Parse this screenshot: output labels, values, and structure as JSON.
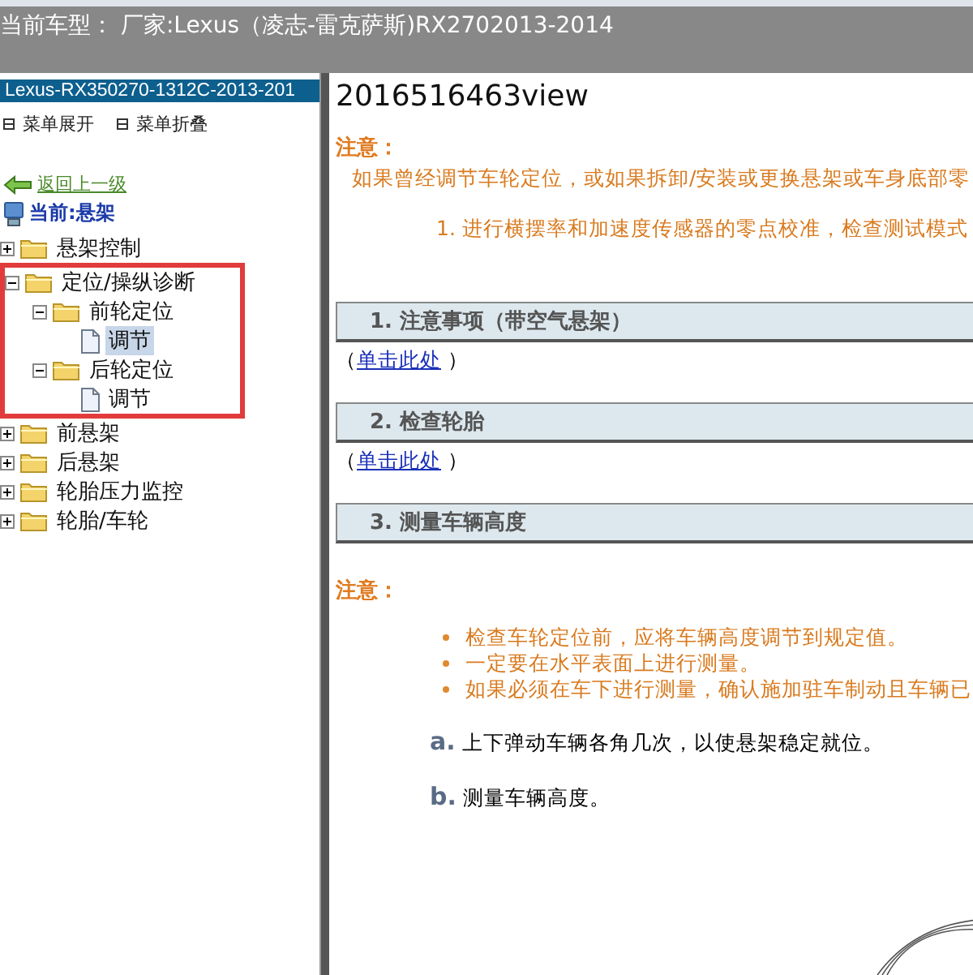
{
  "header": {
    "title": "当前车型： 厂家:Lexus（凌志-雷克萨斯)RX2702013-2014"
  },
  "sidebar": {
    "title": "Lexus-RX350270-1312C-2013-201",
    "actions": [
      {
        "label": "菜单展开"
      },
      {
        "label": "菜单折叠"
      }
    ],
    "back_link": "返回上一级",
    "current": "当前:悬架",
    "tree": [
      {
        "label": "悬架控制",
        "kind": "folder",
        "expanded": false,
        "selected": false,
        "highlighted": false
      },
      {
        "label": "定位/操纵诊断",
        "kind": "folder",
        "expanded": true,
        "selected": false,
        "highlighted": true,
        "children": [
          {
            "label": "前轮定位",
            "kind": "folder",
            "expanded": true,
            "selected": false,
            "highlighted": false,
            "children": [
              {
                "label": "调节",
                "kind": "page",
                "selected": true,
                "highlighted": false
              }
            ]
          },
          {
            "label": "后轮定位",
            "kind": "folder",
            "expanded": true,
            "selected": false,
            "highlighted": false,
            "children": [
              {
                "label": "调节",
                "kind": "page",
                "selected": false,
                "highlighted": false
              }
            ]
          }
        ]
      },
      {
        "label": "前悬架",
        "kind": "folder",
        "expanded": false,
        "selected": false,
        "highlighted": false
      },
      {
        "label": "后悬架",
        "kind": "folder",
        "expanded": false,
        "selected": false,
        "highlighted": false
      },
      {
        "label": "轮胎压力监控",
        "kind": "folder",
        "expanded": false,
        "selected": false,
        "highlighted": false
      },
      {
        "label": "轮胎/车轮",
        "kind": "folder",
        "expanded": false,
        "selected": false,
        "highlighted": false
      }
    ]
  },
  "content": {
    "title": "2016516463view",
    "notice": {
      "label": "注意：",
      "text": "如果曾经调节车轮定位，或如果拆卸/安装或更换悬架或车身底部零",
      "steps": [
        "1. 进行横摆率和加速度传感器的零点校准，检查测试模式"
      ]
    },
    "sections": [
      {
        "heading": "1. 注意事项（带空气悬架）",
        "link_open": "（",
        "link": "单击此处",
        "link_close": " ）"
      },
      {
        "heading": "2. 检查轮胎",
        "link_open": "（",
        "link": "单击此处",
        "link_close": " ）"
      },
      {
        "heading": "3. 测量车辆高度"
      }
    ],
    "notice2": {
      "label": "注意：",
      "bullets": [
        "检查车轮定位前，应将车辆高度调节到规定值。",
        "一定要在水平表面上进行测量。",
        "如果必须在车下进行测量，确认施加驻车制动且车辆已"
      ]
    },
    "steps": [
      {
        "letter": "a.",
        "text": "上下弹动车辆各角几次，以使悬架稳定就位。"
      },
      {
        "letter": "b.",
        "text": "测量车辆高度。"
      }
    ]
  }
}
